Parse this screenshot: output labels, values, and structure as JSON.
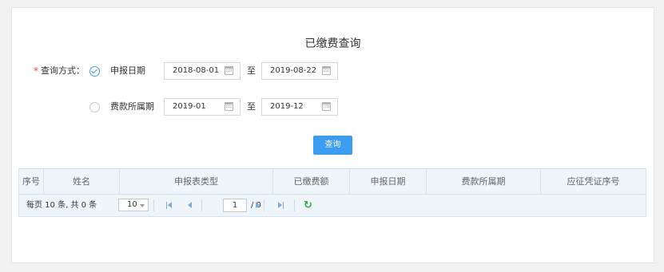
{
  "page": {
    "title": "已缴费查询"
  },
  "form": {
    "required_mark": "*",
    "query_mode_label": "查询方式：",
    "options": [
      {
        "label": "申报日期",
        "checked": true
      },
      {
        "label": "费款所属期",
        "checked": false
      }
    ],
    "declare_date": {
      "start": "2018-08-01",
      "to": "至",
      "end": "2019-08-22"
    },
    "belong_period": {
      "start": "2019-01",
      "to": "至",
      "end": "2019-12"
    },
    "query_button": "查询"
  },
  "table": {
    "columns": [
      "序号",
      "姓名",
      "申报表类型",
      "已缴费额",
      "申报日期",
      "费款所属期",
      "应征凭证序号"
    ],
    "rows": []
  },
  "pager": {
    "summary": "每页 10 条, 共 0 条",
    "page_size": "10",
    "current_page": "1",
    "total_pages": "/ 0"
  },
  "colors": {
    "accent": "#3b9cf0",
    "required": "#e8463b",
    "table_header_bg": "#eef5fb"
  },
  "icons": {
    "radio_checked": "check-circle-icon",
    "calendar": "calendar-icon",
    "refresh": "refresh-icon"
  }
}
